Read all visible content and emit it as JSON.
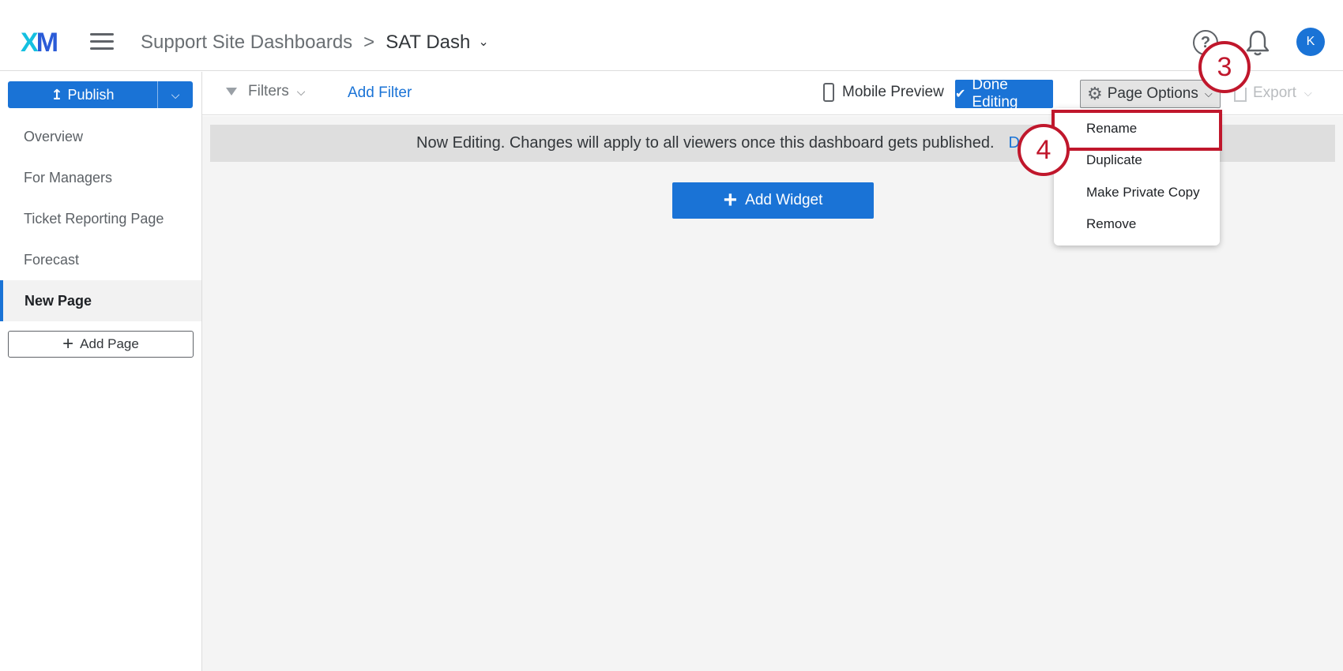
{
  "header": {
    "logo": {
      "x": "X",
      "m": "M"
    },
    "breadcrumb_root": "Support Site Dashboards",
    "breadcrumb_sep": ">",
    "breadcrumb_current": "SAT Dash",
    "help_glyph": "?",
    "avatar_initial": "K"
  },
  "sidebar": {
    "publish_label": "Publish",
    "pages": [
      {
        "label": "Overview"
      },
      {
        "label": "For Managers"
      },
      {
        "label": "Ticket Reporting Page"
      },
      {
        "label": "Forecast"
      },
      {
        "label": "New Page",
        "active": true
      }
    ],
    "add_page_label": "Add Page"
  },
  "toolbar": {
    "filters_label": "Filters",
    "add_filter_label": "Add Filter",
    "mobile_preview_label": "Mobile Preview",
    "done_editing_label": "Done Editing",
    "page_options_label": "Page Options",
    "export_label": "Export"
  },
  "canvas": {
    "notice_text": "Now Editing. Changes will apply to all viewers once this dashboard gets published.",
    "notice_link_partial": "D",
    "add_widget_label": "Add Widget"
  },
  "page_options_menu": {
    "items": [
      "Rename",
      "Duplicate",
      "Make Private Copy",
      "Remove"
    ],
    "highlighted_item": "Rename"
  },
  "annotations": {
    "step_3": "3",
    "step_4": "4",
    "accent_color": "#c0172c"
  },
  "colors": {
    "primary": "#1a73d6",
    "canvas_bg": "#f4f4f4",
    "notice_bg": "#dedede"
  },
  "icons": [
    "menu-icon",
    "chevron-right-icon",
    "chevron-down-icon",
    "help-icon",
    "bell-icon",
    "upload-icon",
    "plus-icon",
    "funnel-icon",
    "phone-icon",
    "check-icon",
    "gear-icon",
    "export-icon"
  ]
}
